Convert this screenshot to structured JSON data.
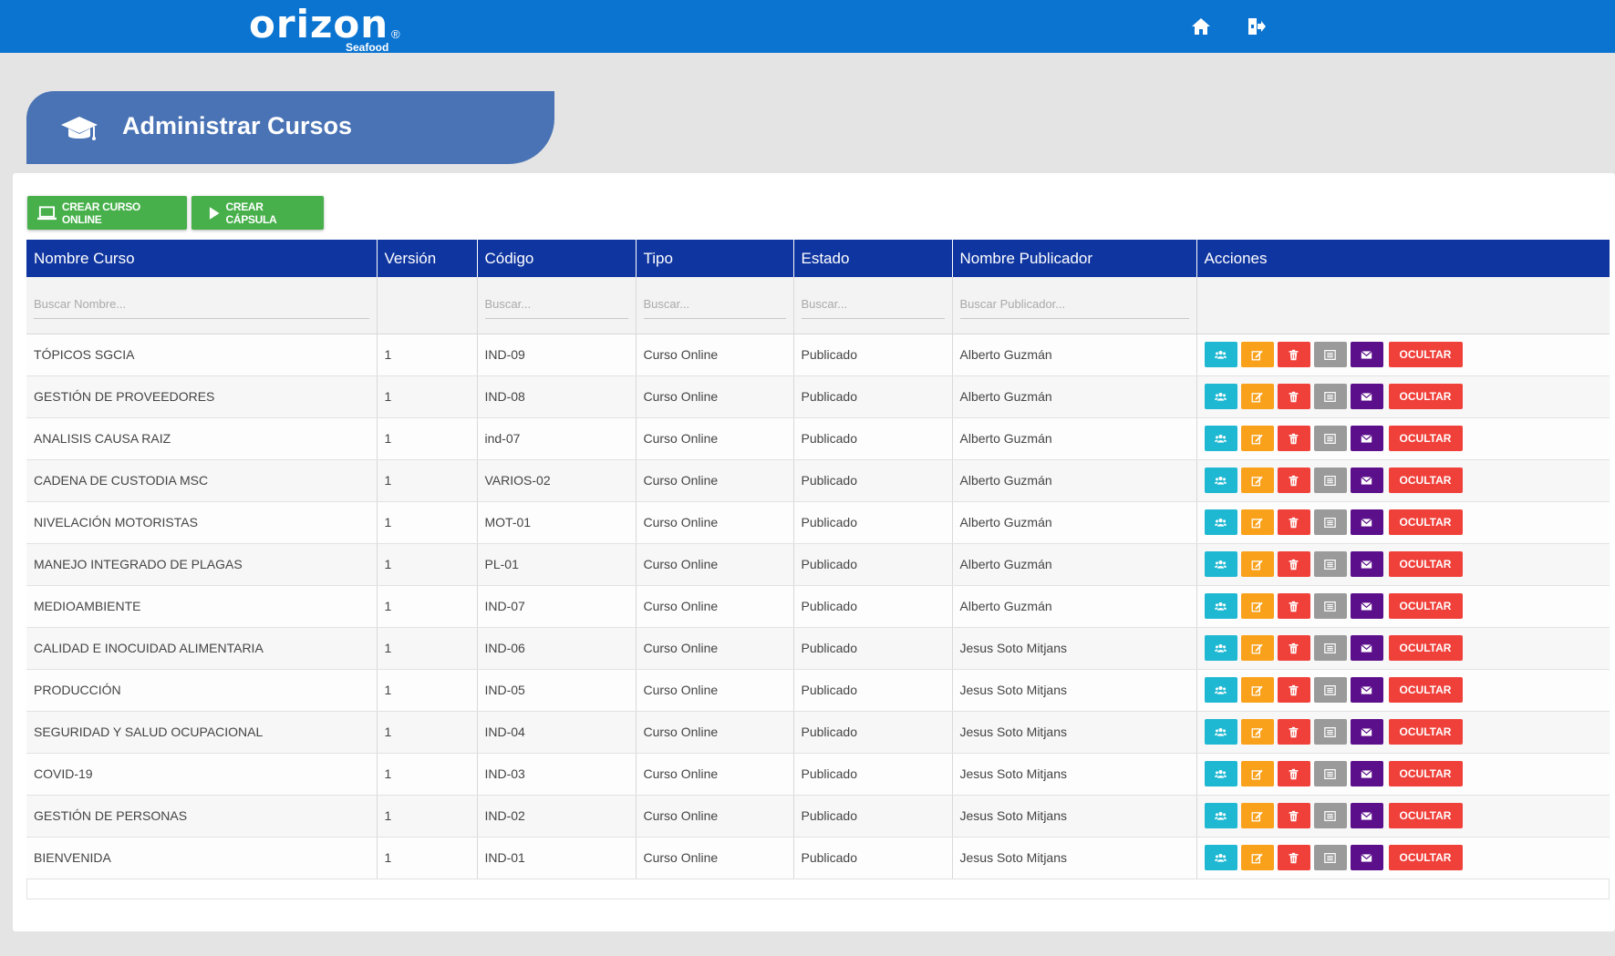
{
  "header": {
    "logo_word": "orizon",
    "logo_reg": "®",
    "logo_sub": "Seafood",
    "home_icon": "home-icon",
    "logout_icon": "logout-icon",
    "bg_color": "#0b74d0"
  },
  "page": {
    "title": "Administrar Cursos",
    "title_icon": "graduation-cap-icon",
    "accent_color": "#4a73b5"
  },
  "toolbar": {
    "create_online_label": "CREAR CURSO ONLINE",
    "create_capsule_label": "CREAR CÁPSULA",
    "create_color": "#47b04b"
  },
  "table": {
    "columns": [
      "Nombre Curso",
      "Versión",
      "Código",
      "Tipo",
      "Estado",
      "Nombre Publicador",
      "Acciones"
    ],
    "filters": {
      "nombre_placeholder": "Buscar Nombre...",
      "codigo_placeholder": "Buscar...",
      "tipo_placeholder": "Buscar...",
      "estado_placeholder": "Buscar...",
      "publicador_placeholder": "Buscar Publicador..."
    },
    "hide_label": "OCULTAR",
    "rows": [
      {
        "nombre": "TÓPICOS SGCIA",
        "version": "1",
        "codigo": "IND-09",
        "tipo": "Curso Online",
        "estado": "Publicado",
        "publicador": "Alberto Guzmán"
      },
      {
        "nombre": "GESTIÓN DE PROVEEDORES",
        "version": "1",
        "codigo": "IND-08",
        "tipo": "Curso Online",
        "estado": "Publicado",
        "publicador": "Alberto Guzmán"
      },
      {
        "nombre": "ANALISIS CAUSA RAIZ",
        "version": "1",
        "codigo": "ind-07",
        "tipo": "Curso Online",
        "estado": "Publicado",
        "publicador": "Alberto Guzmán"
      },
      {
        "nombre": "CADENA DE CUSTODIA MSC",
        "version": "1",
        "codigo": "VARIOS-02",
        "tipo": "Curso Online",
        "estado": "Publicado",
        "publicador": "Alberto Guzmán"
      },
      {
        "nombre": "NIVELACIÓN MOTORISTAS",
        "version": "1",
        "codigo": "MOT-01",
        "tipo": "Curso Online",
        "estado": "Publicado",
        "publicador": "Alberto Guzmán"
      },
      {
        "nombre": "MANEJO INTEGRADO DE PLAGAS",
        "version": "1",
        "codigo": "PL-01",
        "tipo": "Curso Online",
        "estado": "Publicado",
        "publicador": "Alberto Guzmán"
      },
      {
        "nombre": "MEDIOAMBIENTE",
        "version": "1",
        "codigo": "IND-07",
        "tipo": "Curso Online",
        "estado": "Publicado",
        "publicador": "Alberto Guzmán"
      },
      {
        "nombre": "CALIDAD E INOCUIDAD ALIMENTARIA",
        "version": "1",
        "codigo": "IND-06",
        "tipo": "Curso Online",
        "estado": "Publicado",
        "publicador": "Jesus Soto Mitjans"
      },
      {
        "nombre": "PRODUCCIÓN",
        "version": "1",
        "codigo": "IND-05",
        "tipo": "Curso Online",
        "estado": "Publicado",
        "publicador": "Jesus Soto Mitjans"
      },
      {
        "nombre": "SEGURIDAD Y SALUD OCUPACIONAL",
        "version": "1",
        "codigo": "IND-04",
        "tipo": "Curso Online",
        "estado": "Publicado",
        "publicador": "Jesus Soto Mitjans"
      },
      {
        "nombre": "COVID-19",
        "version": "1",
        "codigo": "IND-03",
        "tipo": "Curso Online",
        "estado": "Publicado",
        "publicador": "Jesus Soto Mitjans"
      },
      {
        "nombre": "GESTIÓN DE PERSONAS",
        "version": "1",
        "codigo": "IND-02",
        "tipo": "Curso Online",
        "estado": "Publicado",
        "publicador": "Jesus Soto Mitjans"
      },
      {
        "nombre": "BIENVENIDA",
        "version": "1",
        "codigo": "IND-01",
        "tipo": "Curso Online",
        "estado": "Publicado",
        "publicador": "Jesus Soto Mitjans"
      }
    ],
    "header_color": "#0f35a0",
    "action_colors": {
      "users": "#1eb8d2",
      "edit": "#f9a11b",
      "delete": "#f0403a",
      "details": "#9a9a9a",
      "mail": "#5b0f8a",
      "hide": "#f0403a"
    },
    "action_icons": [
      "users-icon",
      "edit-icon",
      "trash-icon",
      "list-icon",
      "envelope-icon"
    ]
  }
}
